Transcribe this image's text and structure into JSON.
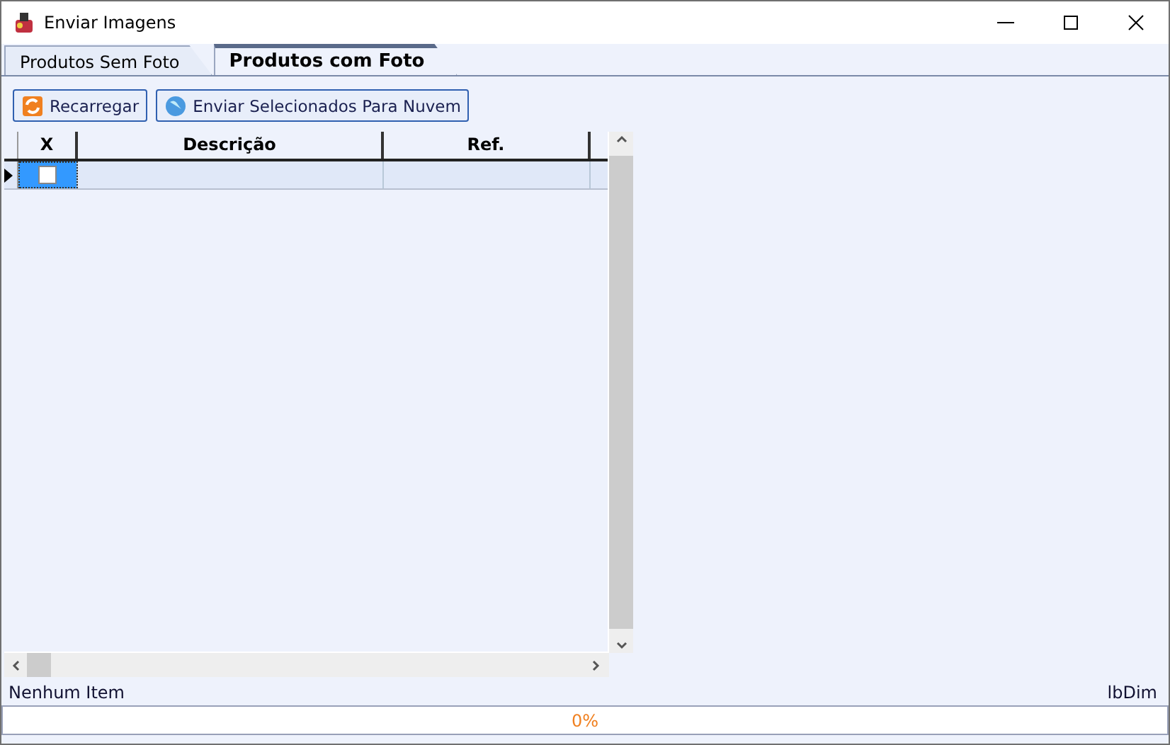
{
  "window": {
    "title": "Enviar Imagens"
  },
  "tabs": [
    {
      "label": "Produtos Sem Foto",
      "selected": false
    },
    {
      "label": "Produtos com Foto",
      "selected": true
    }
  ],
  "toolbar": [
    {
      "label": "Recarregar",
      "kind": "reload"
    },
    {
      "label": "Enviar Selecionados Para Nuvem",
      "kind": "cloud"
    }
  ],
  "table": {
    "columns": [
      "X",
      "Descrição",
      "Ref."
    ],
    "rows": [
      {
        "checked": false,
        "selected": true
      }
    ]
  },
  "status_bar": {
    "left": "Nenhum Item",
    "right": "lbDim"
  },
  "progress": {
    "label": "0%",
    "level": 0
  }
}
